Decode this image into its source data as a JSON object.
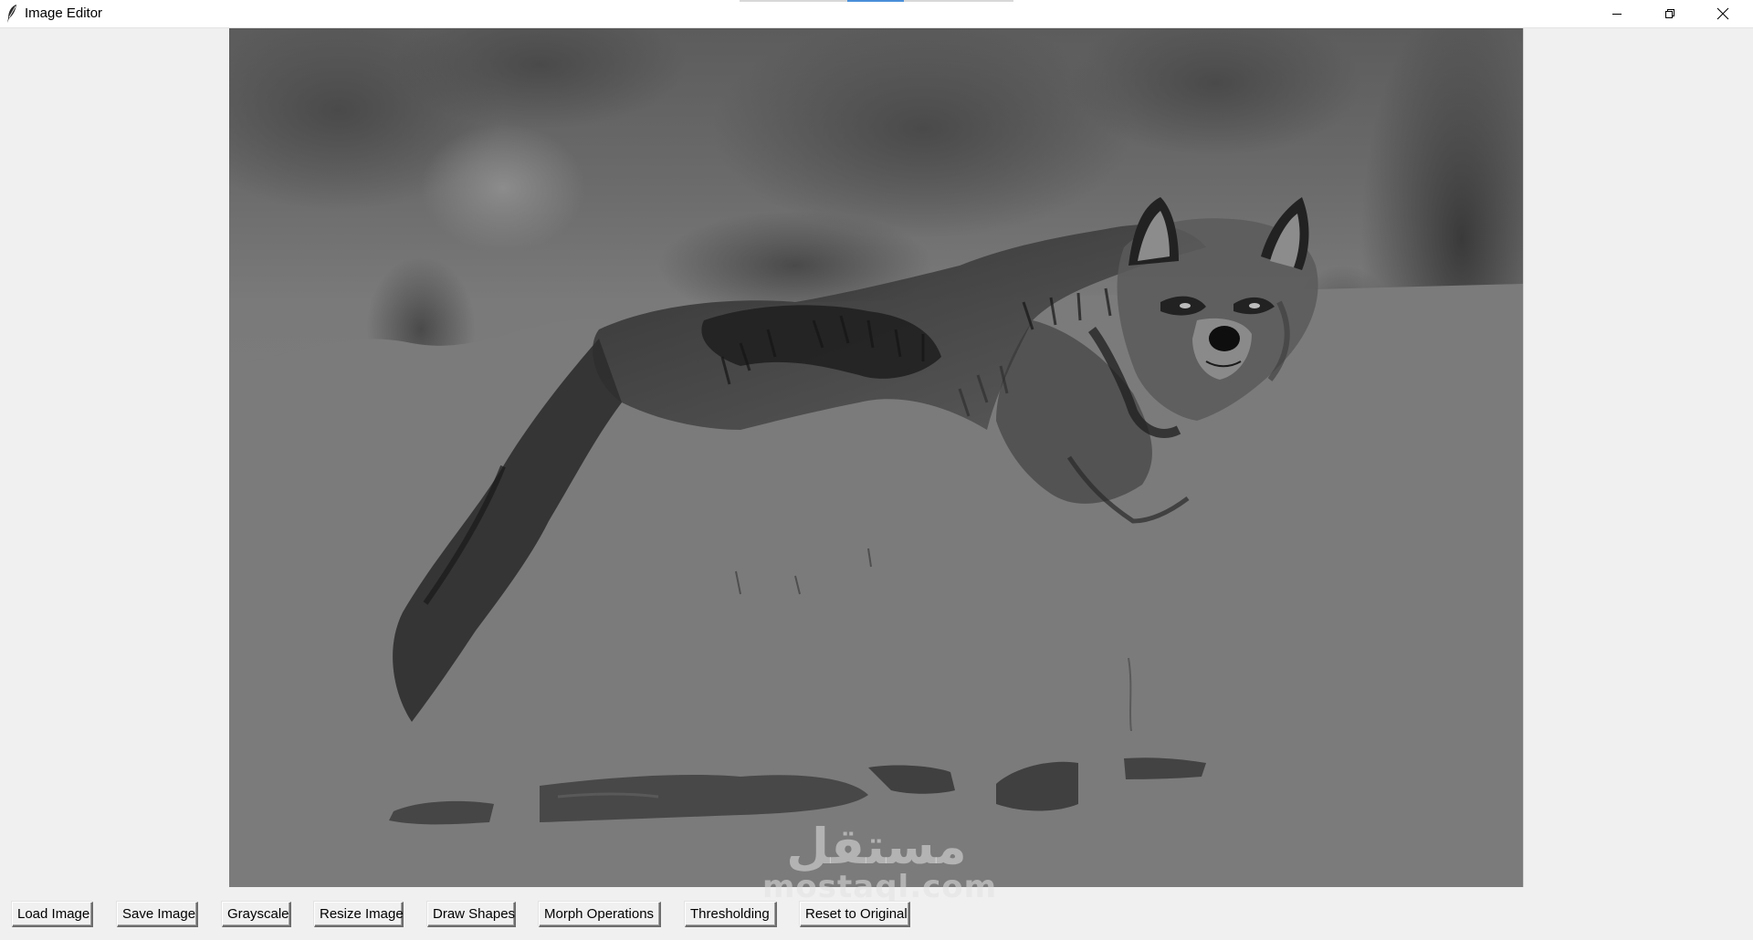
{
  "window": {
    "title": "Image Editor",
    "controls": {
      "minimize_icon": "minimize-icon",
      "maximize_icon": "restore-icon",
      "close_icon": "close-icon"
    }
  },
  "canvas": {
    "description_icon": "image-canvas",
    "watermark_arabic": "مستقل",
    "watermark_latin": "mostaql.com"
  },
  "toolbar": {
    "buttons": [
      {
        "label": "Load Image"
      },
      {
        "label": "Save Image"
      },
      {
        "label": "Grayscale"
      },
      {
        "label": "Resize Image"
      },
      {
        "label": "Draw Shapes"
      },
      {
        "label": "Morph Operations"
      },
      {
        "label": "Thresholding"
      },
      {
        "label": "Reset to Original"
      }
    ]
  },
  "colors": {
    "window_bg": "#f0f0f0",
    "titlebar_bg": "#ffffff",
    "canvas_bg": "#7b7b7b",
    "taskbar_accent": "#4a8fd9"
  }
}
